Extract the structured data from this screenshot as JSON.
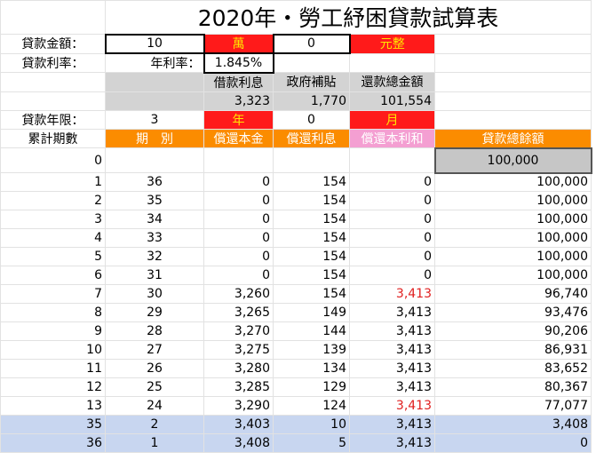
{
  "title": "2020年・勞工紓困貸款試算表",
  "loan_amount": {
    "label": "貸款金額：",
    "value": "10",
    "unit": "萬",
    "extra_value": "0",
    "suffix": "元整"
  },
  "interest": {
    "label": "貸款利率：",
    "annual_label": "年利率：",
    "annual_value": "1.845%"
  },
  "summary": {
    "headers": [
      "借款利息",
      "政府補貼",
      "還款總金額"
    ],
    "values": [
      "3,323",
      "1,770",
      "101,554"
    ]
  },
  "term": {
    "label": "貸款年限：",
    "years": "3",
    "year_unit": "年",
    "months": "0",
    "month_unit": "月"
  },
  "table": {
    "headers": [
      "累計期數",
      "期　別",
      "償還本金",
      "償還利息",
      "償還本利和",
      "貸款總餘額"
    ],
    "initial": {
      "period": "0",
      "balance": "100,000"
    },
    "rows": [
      [
        "1",
        "36",
        "0",
        "154",
        "0",
        "100,000"
      ],
      [
        "2",
        "35",
        "0",
        "154",
        "0",
        "100,000"
      ],
      [
        "3",
        "34",
        "0",
        "154",
        "0",
        "100,000"
      ],
      [
        "4",
        "33",
        "0",
        "154",
        "0",
        "100,000"
      ],
      [
        "5",
        "32",
        "0",
        "154",
        "0",
        "100,000"
      ],
      [
        "6",
        "31",
        "0",
        "154",
        "0",
        "100,000"
      ],
      [
        "7",
        "30",
        "3,260",
        "154",
        "3,413",
        "96,740"
      ],
      [
        "8",
        "29",
        "3,265",
        "149",
        "3,413",
        "93,476"
      ],
      [
        "9",
        "28",
        "3,270",
        "144",
        "3,413",
        "90,206"
      ],
      [
        "10",
        "27",
        "3,275",
        "139",
        "3,413",
        "86,931"
      ],
      [
        "11",
        "26",
        "3,280",
        "134",
        "3,413",
        "83,652"
      ],
      [
        "12",
        "25",
        "3,285",
        "129",
        "3,413",
        "80,367"
      ],
      [
        "13",
        "24",
        "3,290",
        "124",
        "3,413",
        "77,077"
      ],
      [
        "35",
        "2",
        "3,403",
        "10",
        "3,413",
        "3,408"
      ],
      [
        "36",
        "1",
        "3,408",
        "5",
        "3,413",
        "0"
      ]
    ]
  },
  "colors": {
    "red": "#ff1a1a",
    "yellow_text": "#ffe600",
    "orange": "#fb8c00",
    "pink": "#f49fd2",
    "gray": "#d3d3d3",
    "blue": "#c8d6f0",
    "red_text": "#e02020"
  }
}
